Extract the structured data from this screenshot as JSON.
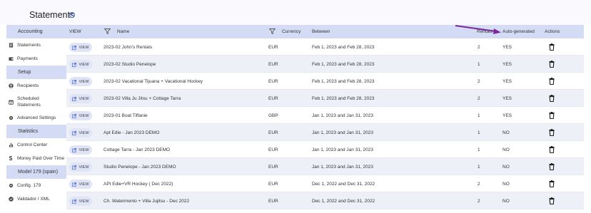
{
  "header": {
    "title": "Statements",
    "info_icon": "info-icon"
  },
  "sidebar": {
    "sections": [
      {
        "header": "Accounting",
        "items": [
          {
            "label": "Statements",
            "icon": "document-icon"
          },
          {
            "label": "Payments",
            "icon": "wallet-icon"
          }
        ]
      },
      {
        "header": "Setup",
        "items": [
          {
            "label": "Recipients",
            "icon": "person-icon"
          },
          {
            "label": "Scheduled Statements",
            "icon": "calendar-icon"
          },
          {
            "label": "Advanced Settings",
            "icon": "gear-icon"
          }
        ]
      },
      {
        "header": "Statistics",
        "items": [
          {
            "label": "Control Center",
            "icon": "bar-chart-icon"
          },
          {
            "label": "Money Paid Over Time",
            "icon": "dollar-icon"
          }
        ]
      },
      {
        "header": "Model 179 (spain)",
        "items": [
          {
            "label": "Config. 179",
            "icon": "gear-icon"
          },
          {
            "label": "Validador / XML",
            "icon": "check-icon"
          }
        ]
      }
    ]
  },
  "table": {
    "columns": {
      "view": "VIEW",
      "name": "Name",
      "currency": "Currency",
      "between": "Between",
      "rentals": "Rentals",
      "auto_generated": "Auto-generated",
      "actions": "Actions"
    },
    "view_button_label": "VIEW",
    "rows": [
      {
        "name": "2023-02 John's Rentals",
        "currency": "EUR",
        "between": "Feb 1, 2023 and Feb 28, 2023",
        "rentals": "2",
        "auto": "YES"
      },
      {
        "name": "2023-02 Studio Penelope",
        "currency": "EUR",
        "between": "Feb 1, 2023 and Feb 28, 2023",
        "rentals": "1",
        "auto": "YES"
      },
      {
        "name": "2023-02 Vacational Tijuana + Vacational Hockey",
        "currency": "EUR",
        "between": "Feb 1, 2023 and Feb 28, 2023",
        "rentals": "2",
        "auto": "YES"
      },
      {
        "name": "2023-02 Villa Ju Jitsu + Cottage Tarra",
        "currency": "EUR",
        "between": "Feb 1, 2023 and Feb 28, 2023",
        "rentals": "2",
        "auto": "YES"
      },
      {
        "name": "2023-01 Boat Tiffanie",
        "currency": "GBP",
        "between": "Jan 1, 2023 and Jan 31, 2023",
        "rentals": "1",
        "auto": "YES"
      },
      {
        "name": "Apt Edie - Jan 2023 DEMO",
        "currency": "EUR",
        "between": "Jan 1, 2023 and Jan 31, 2023",
        "rentals": "1",
        "auto": "NO"
      },
      {
        "name": "Cottage Tarra - Jan 2023 DEMO",
        "currency": "EUR",
        "between": "Jan 1, 2023 and Jan 31, 2023",
        "rentals": "1",
        "auto": "NO"
      },
      {
        "name": "Studio Penelope - Jan 2023 DEMO",
        "currency": "EUR",
        "between": "Jan 1, 2023 and Jan 31, 2023",
        "rentals": "1",
        "auto": "NO"
      },
      {
        "name": "APt Edie+VR Hockey ( Dec 2022)",
        "currency": "EUR",
        "between": "Dec 1, 2022 and Dec 31, 2022",
        "rentals": "2",
        "auto": "NO"
      },
      {
        "name": "Ch. Watermenlo + Villa Jujitsu - Dec 2022",
        "currency": "EUR",
        "between": "Dec 1, 2022 and Dec 31, 2022",
        "rentals": "2",
        "auto": "NO"
      }
    ]
  },
  "colors": {
    "header_bg": "#d3dcf4",
    "alt_row": "#eef0f7",
    "arrow": "#7b2a9b",
    "accent": "#4a6fd0"
  }
}
